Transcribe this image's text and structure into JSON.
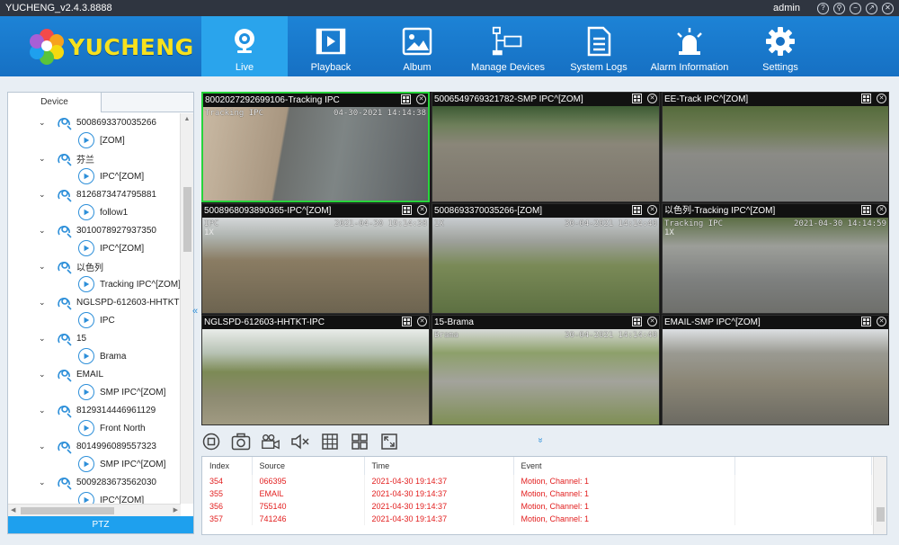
{
  "window": {
    "title": "YUCHENG_v2.4.3.8888",
    "user": "admin",
    "buttons": [
      "?",
      "⚲",
      "−",
      "↗",
      "✕"
    ]
  },
  "logo": {
    "text": "YUCHENG"
  },
  "nav": [
    {
      "label": "Live",
      "icon": "webcam-icon",
      "active": true
    },
    {
      "label": "Playback",
      "icon": "film-play-icon"
    },
    {
      "label": "Album",
      "icon": "picture-icon"
    },
    {
      "label": "Manage Devices",
      "icon": "network-device-icon"
    },
    {
      "label": "System Logs",
      "icon": "document-icon"
    },
    {
      "label": "Alarm Information",
      "icon": "alarm-light-icon"
    },
    {
      "label": "Settings",
      "icon": "gear-icon"
    }
  ],
  "sidebar": {
    "tab": "Device",
    "tree": [
      {
        "type": "device",
        "label": "5008693370035266"
      },
      {
        "type": "channel",
        "label": "[ZOM]"
      },
      {
        "type": "device",
        "label": "芬兰"
      },
      {
        "type": "channel",
        "label": "IPC^[ZOM]"
      },
      {
        "type": "device",
        "label": "8126873474795881"
      },
      {
        "type": "channel",
        "label": "follow1"
      },
      {
        "type": "device",
        "label": "3010078927937350"
      },
      {
        "type": "channel",
        "label": "IPC^[ZOM]"
      },
      {
        "type": "device",
        "label": "以色列"
      },
      {
        "type": "channel",
        "label": "Tracking IPC^[ZOM]"
      },
      {
        "type": "device",
        "label": "NGLSPD-612603-HHTKT"
      },
      {
        "type": "channel",
        "label": "IPC"
      },
      {
        "type": "device",
        "label": "15"
      },
      {
        "type": "channel",
        "label": "Brama"
      },
      {
        "type": "device",
        "label": "EMAIL"
      },
      {
        "type": "channel",
        "label": "SMP IPC^[ZOM]"
      },
      {
        "type": "device",
        "label": "8129314446961129"
      },
      {
        "type": "channel",
        "label": "Front North"
      },
      {
        "type": "device",
        "label": "8014996089557323"
      },
      {
        "type": "channel",
        "label": "SMP IPC^[ZOM]"
      },
      {
        "type": "device",
        "label": "5009283673562030"
      },
      {
        "type": "channel",
        "label": "IPC^[ZOM]"
      }
    ],
    "ptz_label": "PTZ",
    "collapse_glyph": "«"
  },
  "cameras": [
    {
      "caption": "8002027292699106-Tracking IPC",
      "osd_left": "Tracking IPC",
      "osd_right": "04-30-2021 14:14:38",
      "osd_line2": "",
      "selected": true
    },
    {
      "caption": "5006549769321782-SMP IPC^[ZOM]",
      "osd_left": "",
      "osd_right": "",
      "osd_line2": ""
    },
    {
      "caption": "EE-Track IPC^[ZOM]",
      "osd_left": "",
      "osd_right": "",
      "osd_line2": ""
    },
    {
      "caption": "5008968093890365-IPC^[ZOM]",
      "osd_left": "IPC",
      "osd_right": "2021-04-30 19:14:38",
      "osd_line2": "1X"
    },
    {
      "caption": "5008693370035266-[ZOM]",
      "osd_left": "1X",
      "osd_right": "30-04-2021 14:14:40",
      "osd_line2": ""
    },
    {
      "caption": "以色列-Tracking IPC^[ZOM]",
      "osd_left": "Tracking IPC",
      "osd_right": "2021-04-30 14:14:59",
      "osd_line2": "1X"
    },
    {
      "caption": "NGLSPD-612603-HHTKT-IPC",
      "osd_left": "",
      "osd_right": "",
      "osd_line2": ""
    },
    {
      "caption": "15-Brama",
      "osd_left": "Brama",
      "osd_right": "30-04-2021 14:14:40",
      "osd_line2": ""
    },
    {
      "caption": "EMAIL-SMP IPC^[ZOM]",
      "osd_left": "",
      "osd_right": "",
      "osd_line2": ""
    }
  ],
  "toolbar": [
    "stop-icon",
    "snapshot-camera-icon",
    "record-video-icon",
    "mute-icon",
    "grid-layout-icon",
    "split-screen-icon",
    "fullscreen-icon"
  ],
  "expand_glyph": "»",
  "events": {
    "columns": [
      "Index",
      "Source",
      "Time",
      "Event"
    ],
    "rows": [
      [
        "354",
        "066395",
        "2021-04-30 19:14:37",
        "Motion, Channel: 1"
      ],
      [
        "355",
        "EMAIL",
        "2021-04-30 19:14:37",
        "Motion, Channel: 1"
      ],
      [
        "356",
        "755140",
        "2021-04-30 19:14:37",
        "Motion, Channel: 1"
      ],
      [
        "357",
        "741246",
        "2021-04-30 19:14:37",
        "Motion, Channel: 1"
      ]
    ]
  },
  "colors": {
    "nav_bg": "#1670c3",
    "nav_active": "#2aa4ec",
    "event_text": "#e21e1e",
    "selected_border": "#27d43b",
    "logo_text": "#f7e11e"
  }
}
